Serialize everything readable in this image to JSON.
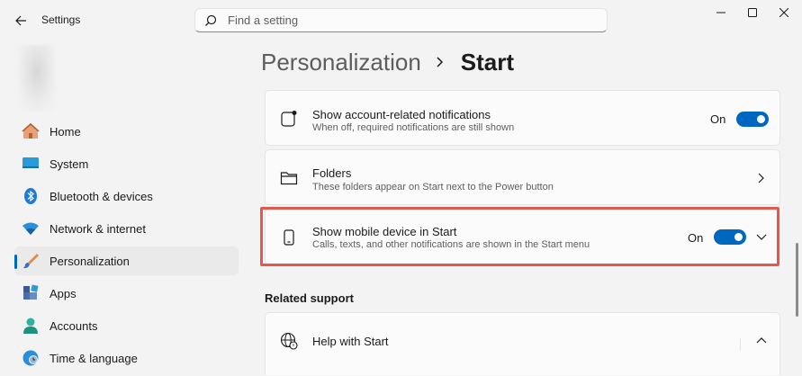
{
  "window": {
    "title": "Settings"
  },
  "search": {
    "placeholder": "Find a setting"
  },
  "user": {
    "name": "",
    "email": ""
  },
  "sidebar": {
    "items": [
      {
        "label": "Home",
        "icon": "home-icon"
      },
      {
        "label": "System",
        "icon": "system-icon"
      },
      {
        "label": "Bluetooth & devices",
        "icon": "bluetooth-icon"
      },
      {
        "label": "Network & internet",
        "icon": "network-icon"
      },
      {
        "label": "Personalization",
        "icon": "personalization-icon",
        "active": true
      },
      {
        "label": "Apps",
        "icon": "apps-icon"
      },
      {
        "label": "Accounts",
        "icon": "accounts-icon"
      },
      {
        "label": "Time & language",
        "icon": "time-language-icon"
      }
    ]
  },
  "breadcrumb": {
    "parent": "Personalization",
    "current": "Start"
  },
  "settings": {
    "account_notifications": {
      "title": "Show account-related notifications",
      "subtitle": "When off, required notifications are still shown",
      "state_label": "On",
      "enabled": true
    },
    "folders": {
      "title": "Folders",
      "subtitle": "These folders appear on Start next to the Power button"
    },
    "mobile_device": {
      "title": "Show mobile device in Start",
      "subtitle": "Calls, texts, and other notifications are shown in the Start menu",
      "state_label": "On",
      "enabled": true
    }
  },
  "related_support": {
    "heading": "Related support",
    "help_item": "Help with Start"
  },
  "colors": {
    "accent": "#0067c0",
    "highlight": "#e05a4f"
  }
}
